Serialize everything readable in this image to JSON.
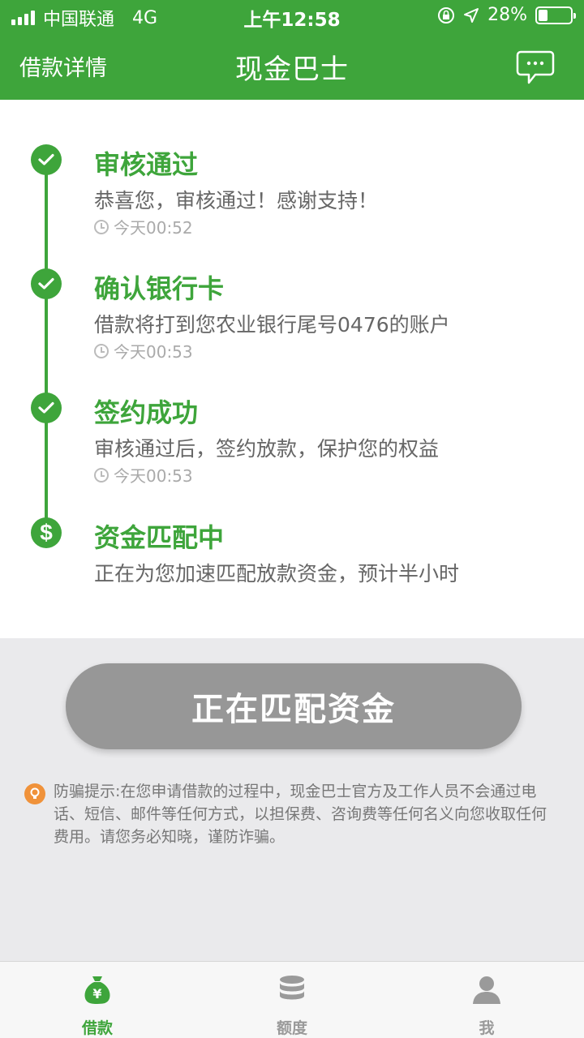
{
  "status_bar": {
    "carrier": "中国联通",
    "network": "4G",
    "time": "上午12:58",
    "battery": "28%"
  },
  "nav": {
    "back_label": "借款详情",
    "title": "现金巴士"
  },
  "steps": [
    {
      "title": "审核通过",
      "desc": "恭喜您，审核通过！感谢支持！",
      "time": "今天00:52",
      "icon": "check-icon"
    },
    {
      "title": "确认银行卡",
      "desc": "借款将打到您农业银行尾号0476的账户",
      "time": "今天00:53",
      "icon": "check-icon"
    },
    {
      "title": "签约成功",
      "desc": "审核通过后，签约放款，保护您的权益",
      "time": "今天00:53",
      "icon": "check-icon"
    },
    {
      "title": "资金匹配中",
      "desc": "正在为您加速匹配放款资金，预计半小时",
      "time": "",
      "icon": "dollar-icon"
    }
  ],
  "main_button": "正在匹配资金",
  "notice": "防骗提示:在您申请借款的过程中，现金巴士官方及工作人员不会通过电话、短信、邮件等任何方式，以担保费、咨询费等任何名义向您收取任何费用。请您务必知晓，谨防诈骗。",
  "tabs": [
    {
      "label": "借款",
      "active": true
    },
    {
      "label": "额度",
      "active": false
    },
    {
      "label": "我",
      "active": false
    }
  ],
  "colors": {
    "brand": "#3ea53b",
    "button": "#979797",
    "notice_icon": "#f0923a"
  }
}
